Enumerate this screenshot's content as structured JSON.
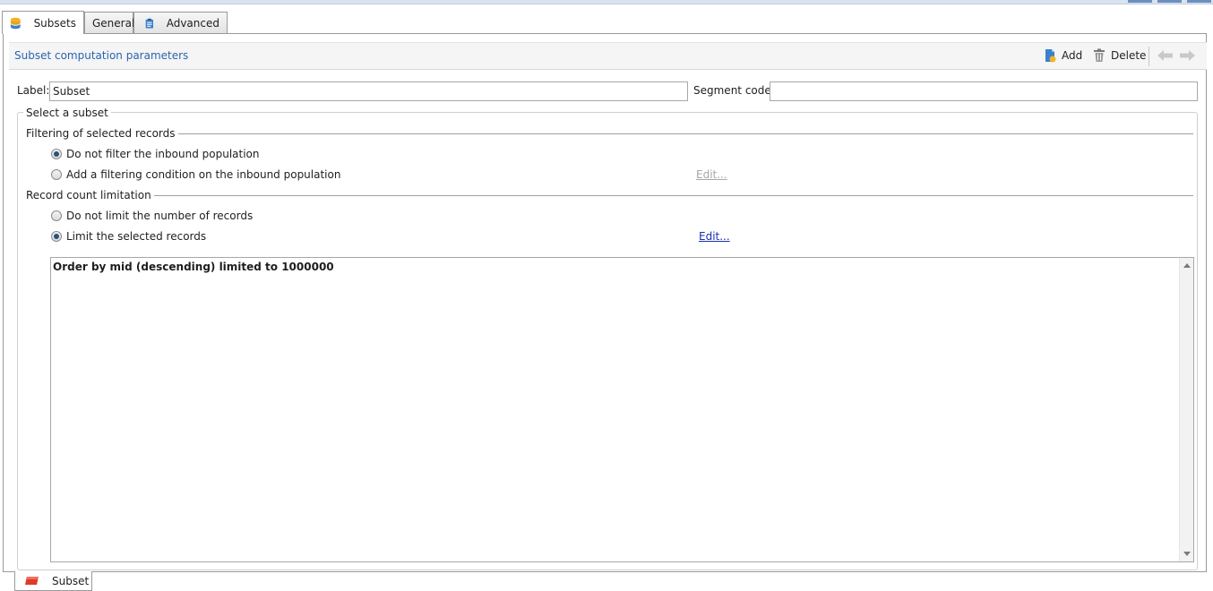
{
  "tabs": [
    {
      "label": "Subsets",
      "icon": "database-icon",
      "active": true
    },
    {
      "label": "General",
      "active": false
    },
    {
      "label": "Advanced",
      "icon": "clipboard-icon",
      "active": false
    }
  ],
  "section": {
    "title": "Subset computation parameters",
    "add_label": "Add",
    "delete_label": "Delete"
  },
  "fields": {
    "label_caption": "Label:",
    "label_value": "Subset",
    "segment_caption": "Segment code:",
    "segment_value": ""
  },
  "group": {
    "legend": "Select a subset",
    "filtering": {
      "title": "Filtering of selected records",
      "options": [
        {
          "label": "Do not filter the inbound population",
          "selected": true
        },
        {
          "label": "Add a filtering condition on the inbound population",
          "selected": false
        }
      ],
      "edit_label": "Edit..."
    },
    "limitation": {
      "title": "Record count limitation",
      "options": [
        {
          "label": "Do not limit the number of records",
          "selected": false
        },
        {
          "label": "Limit the selected records",
          "selected": true
        }
      ],
      "edit_label": "Edit..."
    },
    "summary": "Order by mid (descending) limited to 1000000"
  },
  "bottom_tab": {
    "label": "Subset",
    "icon": "subset-icon"
  },
  "colors": {
    "accent": "#2a64b0",
    "link": "#1a2fb0"
  }
}
